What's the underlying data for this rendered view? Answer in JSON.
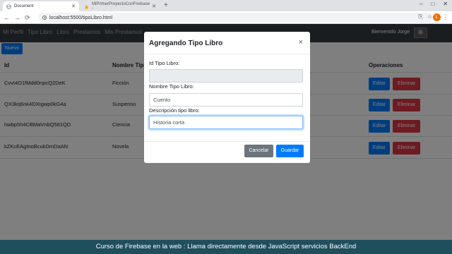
{
  "browser": {
    "tabs": [
      {
        "title": "Document",
        "active": true
      },
      {
        "title": "MiPrimerProyectoConFirebase -",
        "active": false
      }
    ],
    "new_tab": "+",
    "window_controls": [
      "–",
      "□",
      "✕"
    ],
    "nav": {
      "back": "←",
      "forward": "→",
      "reload": "⟳"
    },
    "url": "localhost:5500/tipoLibro.html",
    "profile_initial": "L"
  },
  "navbar": {
    "links": [
      "Mi Perfil",
      "Tipo Libro",
      "Libro",
      "Prestamos",
      "Mis Prestamos"
    ],
    "welcome": "Bienvenido Jorge"
  },
  "page": {
    "new_button": "Nuevo",
    "columns": {
      "id": "Id",
      "nombre": "Nombre Tipo",
      "operaciones": "Operaciones"
    },
    "rows": [
      {
        "id": "CvvI4O1fMdd0npcQ2DeK",
        "nombre": "Ficción"
      },
      {
        "id": "QX3kq6nk4DXIgwp0kG4a",
        "nombre": "Suspenso"
      },
      {
        "id": "hwbp5h4CBMaVnbQ581QD",
        "nombre": "Ciencia"
      },
      {
        "id": "kZKcEAgInoBcukDmDaAN",
        "nombre": "Novela"
      }
    ],
    "edit_label": "Editar",
    "delete_label": "Eliminar"
  },
  "modal": {
    "title": "Agregando Tipo Libro",
    "close": "×",
    "fields": {
      "id_label": "Id Tipo Libro:",
      "id_value": "",
      "nombre_label": "Nombre Tipo Libro:",
      "nombre_value": "Cuento",
      "descripcion_label": "Descripción tipo libro:",
      "descripcion_value": "Historia corta"
    },
    "cancel": "Cancelar",
    "save": "Guardar"
  },
  "caption": "Curso de Firebase en la web : Llama directamente desde JavaScript servicios BackEnd",
  "colors": {
    "primary": "#007bff",
    "danger": "#dc3545",
    "secondary": "#6c757d",
    "navbar": "#343a40",
    "caption_bg": "#1f4e5c"
  }
}
